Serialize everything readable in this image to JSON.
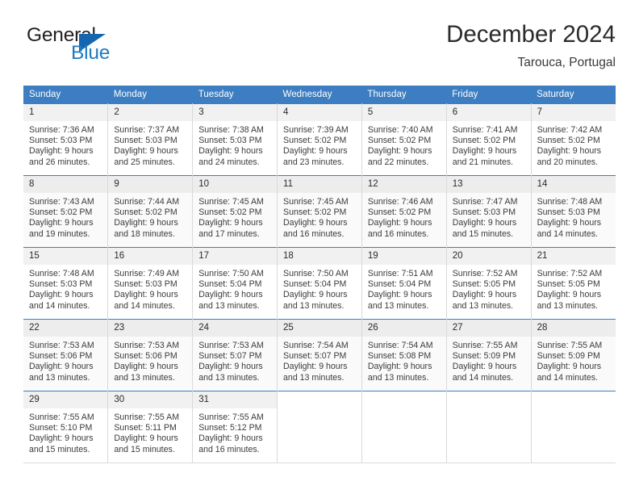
{
  "brand": {
    "word_one": "General",
    "word_two": "Blue",
    "triangle_color": "#1566ae",
    "blue_color": "#1f7ac4"
  },
  "header": {
    "title": "December 2024",
    "location": "Tarouca, Portugal"
  },
  "theme": {
    "header_band": "#3c7ec1",
    "day_number_band": "#f1f1f1",
    "grid_line": "#d9d9d9"
  },
  "weekdays": [
    "Sunday",
    "Monday",
    "Tuesday",
    "Wednesday",
    "Thursday",
    "Friday",
    "Saturday"
  ],
  "weeks": [
    [
      {
        "day": "1",
        "sunrise": "Sunrise: 7:36 AM",
        "sunset": "Sunset: 5:03 PM",
        "daylight_1": "Daylight: 9 hours",
        "daylight_2": "and 26 minutes."
      },
      {
        "day": "2",
        "sunrise": "Sunrise: 7:37 AM",
        "sunset": "Sunset: 5:03 PM",
        "daylight_1": "Daylight: 9 hours",
        "daylight_2": "and 25 minutes."
      },
      {
        "day": "3",
        "sunrise": "Sunrise: 7:38 AM",
        "sunset": "Sunset: 5:03 PM",
        "daylight_1": "Daylight: 9 hours",
        "daylight_2": "and 24 minutes."
      },
      {
        "day": "4",
        "sunrise": "Sunrise: 7:39 AM",
        "sunset": "Sunset: 5:02 PM",
        "daylight_1": "Daylight: 9 hours",
        "daylight_2": "and 23 minutes."
      },
      {
        "day": "5",
        "sunrise": "Sunrise: 7:40 AM",
        "sunset": "Sunset: 5:02 PM",
        "daylight_1": "Daylight: 9 hours",
        "daylight_2": "and 22 minutes."
      },
      {
        "day": "6",
        "sunrise": "Sunrise: 7:41 AM",
        "sunset": "Sunset: 5:02 PM",
        "daylight_1": "Daylight: 9 hours",
        "daylight_2": "and 21 minutes."
      },
      {
        "day": "7",
        "sunrise": "Sunrise: 7:42 AM",
        "sunset": "Sunset: 5:02 PM",
        "daylight_1": "Daylight: 9 hours",
        "daylight_2": "and 20 minutes."
      }
    ],
    [
      {
        "day": "8",
        "sunrise": "Sunrise: 7:43 AM",
        "sunset": "Sunset: 5:02 PM",
        "daylight_1": "Daylight: 9 hours",
        "daylight_2": "and 19 minutes."
      },
      {
        "day": "9",
        "sunrise": "Sunrise: 7:44 AM",
        "sunset": "Sunset: 5:02 PM",
        "daylight_1": "Daylight: 9 hours",
        "daylight_2": "and 18 minutes."
      },
      {
        "day": "10",
        "sunrise": "Sunrise: 7:45 AM",
        "sunset": "Sunset: 5:02 PM",
        "daylight_1": "Daylight: 9 hours",
        "daylight_2": "and 17 minutes."
      },
      {
        "day": "11",
        "sunrise": "Sunrise: 7:45 AM",
        "sunset": "Sunset: 5:02 PM",
        "daylight_1": "Daylight: 9 hours",
        "daylight_2": "and 16 minutes."
      },
      {
        "day": "12",
        "sunrise": "Sunrise: 7:46 AM",
        "sunset": "Sunset: 5:02 PM",
        "daylight_1": "Daylight: 9 hours",
        "daylight_2": "and 16 minutes."
      },
      {
        "day": "13",
        "sunrise": "Sunrise: 7:47 AM",
        "sunset": "Sunset: 5:03 PM",
        "daylight_1": "Daylight: 9 hours",
        "daylight_2": "and 15 minutes."
      },
      {
        "day": "14",
        "sunrise": "Sunrise: 7:48 AM",
        "sunset": "Sunset: 5:03 PM",
        "daylight_1": "Daylight: 9 hours",
        "daylight_2": "and 14 minutes."
      }
    ],
    [
      {
        "day": "15",
        "sunrise": "Sunrise: 7:48 AM",
        "sunset": "Sunset: 5:03 PM",
        "daylight_1": "Daylight: 9 hours",
        "daylight_2": "and 14 minutes."
      },
      {
        "day": "16",
        "sunrise": "Sunrise: 7:49 AM",
        "sunset": "Sunset: 5:03 PM",
        "daylight_1": "Daylight: 9 hours",
        "daylight_2": "and 14 minutes."
      },
      {
        "day": "17",
        "sunrise": "Sunrise: 7:50 AM",
        "sunset": "Sunset: 5:04 PM",
        "daylight_1": "Daylight: 9 hours",
        "daylight_2": "and 13 minutes."
      },
      {
        "day": "18",
        "sunrise": "Sunrise: 7:50 AM",
        "sunset": "Sunset: 5:04 PM",
        "daylight_1": "Daylight: 9 hours",
        "daylight_2": "and 13 minutes."
      },
      {
        "day": "19",
        "sunrise": "Sunrise: 7:51 AM",
        "sunset": "Sunset: 5:04 PM",
        "daylight_1": "Daylight: 9 hours",
        "daylight_2": "and 13 minutes."
      },
      {
        "day": "20",
        "sunrise": "Sunrise: 7:52 AM",
        "sunset": "Sunset: 5:05 PM",
        "daylight_1": "Daylight: 9 hours",
        "daylight_2": "and 13 minutes."
      },
      {
        "day": "21",
        "sunrise": "Sunrise: 7:52 AM",
        "sunset": "Sunset: 5:05 PM",
        "daylight_1": "Daylight: 9 hours",
        "daylight_2": "and 13 minutes."
      }
    ],
    [
      {
        "day": "22",
        "sunrise": "Sunrise: 7:53 AM",
        "sunset": "Sunset: 5:06 PM",
        "daylight_1": "Daylight: 9 hours",
        "daylight_2": "and 13 minutes."
      },
      {
        "day": "23",
        "sunrise": "Sunrise: 7:53 AM",
        "sunset": "Sunset: 5:06 PM",
        "daylight_1": "Daylight: 9 hours",
        "daylight_2": "and 13 minutes."
      },
      {
        "day": "24",
        "sunrise": "Sunrise: 7:53 AM",
        "sunset": "Sunset: 5:07 PM",
        "daylight_1": "Daylight: 9 hours",
        "daylight_2": "and 13 minutes."
      },
      {
        "day": "25",
        "sunrise": "Sunrise: 7:54 AM",
        "sunset": "Sunset: 5:07 PM",
        "daylight_1": "Daylight: 9 hours",
        "daylight_2": "and 13 minutes."
      },
      {
        "day": "26",
        "sunrise": "Sunrise: 7:54 AM",
        "sunset": "Sunset: 5:08 PM",
        "daylight_1": "Daylight: 9 hours",
        "daylight_2": "and 13 minutes."
      },
      {
        "day": "27",
        "sunrise": "Sunrise: 7:55 AM",
        "sunset": "Sunset: 5:09 PM",
        "daylight_1": "Daylight: 9 hours",
        "daylight_2": "and 14 minutes."
      },
      {
        "day": "28",
        "sunrise": "Sunrise: 7:55 AM",
        "sunset": "Sunset: 5:09 PM",
        "daylight_1": "Daylight: 9 hours",
        "daylight_2": "and 14 minutes."
      }
    ],
    [
      {
        "day": "29",
        "sunrise": "Sunrise: 7:55 AM",
        "sunset": "Sunset: 5:10 PM",
        "daylight_1": "Daylight: 9 hours",
        "daylight_2": "and 15 minutes."
      },
      {
        "day": "30",
        "sunrise": "Sunrise: 7:55 AM",
        "sunset": "Sunset: 5:11 PM",
        "daylight_1": "Daylight: 9 hours",
        "daylight_2": "and 15 minutes."
      },
      {
        "day": "31",
        "sunrise": "Sunrise: 7:55 AM",
        "sunset": "Sunset: 5:12 PM",
        "daylight_1": "Daylight: 9 hours",
        "daylight_2": "and 16 minutes."
      },
      {
        "day": "",
        "sunrise": "",
        "sunset": "",
        "daylight_1": "",
        "daylight_2": ""
      },
      {
        "day": "",
        "sunrise": "",
        "sunset": "",
        "daylight_1": "",
        "daylight_2": ""
      },
      {
        "day": "",
        "sunrise": "",
        "sunset": "",
        "daylight_1": "",
        "daylight_2": ""
      },
      {
        "day": "",
        "sunrise": "",
        "sunset": "",
        "daylight_1": "",
        "daylight_2": ""
      }
    ]
  ]
}
